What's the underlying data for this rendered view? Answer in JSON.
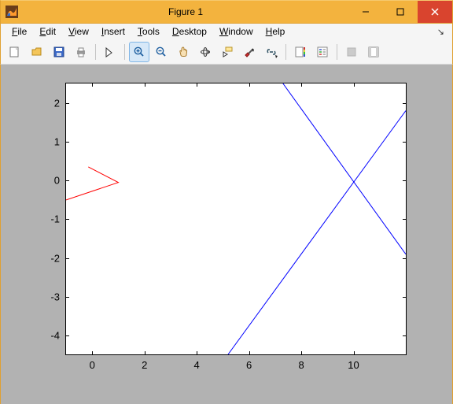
{
  "window": {
    "title": "Figure 1",
    "accent": "#f3b33e",
    "close_color": "#d9442e"
  },
  "menubar": {
    "items": [
      {
        "label": "File",
        "u": "F"
      },
      {
        "label": "Edit",
        "u": "E"
      },
      {
        "label": "View",
        "u": "V"
      },
      {
        "label": "Insert",
        "u": "I"
      },
      {
        "label": "Tools",
        "u": "T"
      },
      {
        "label": "Desktop",
        "u": "D"
      },
      {
        "label": "Window",
        "u": "W"
      },
      {
        "label": "Help",
        "u": "H"
      }
    ]
  },
  "toolbar": {
    "buttons": [
      "new-figure",
      "open",
      "save",
      "print",
      "|",
      "edit-plot",
      "|",
      "zoom-in",
      "zoom-out",
      "pan",
      "rotate3d",
      "data-cursor",
      "brush",
      "link",
      "|",
      "insert-colorbar",
      "insert-legend",
      "|",
      "hide-plot-tools",
      "show-plot-tools"
    ],
    "active": "zoom-in"
  },
  "chart_data": {
    "type": "line",
    "x": [
      -1,
      12
    ],
    "series": [
      {
        "name": "line1",
        "color": "#0000ff",
        "points": [
          [
            5.2,
            -4.48
          ],
          [
            12,
            1.8
          ]
        ]
      },
      {
        "name": "line2",
        "color": "#0000ff",
        "points": [
          [
            7.3,
            2.5
          ],
          [
            12,
            -1.9
          ]
        ]
      },
      {
        "name": "arrow",
        "color": "#ff0000",
        "points": [
          [
            -1,
            -0.5
          ],
          [
            1,
            -0.05
          ],
          [
            -0.15,
            0.35
          ]
        ]
      }
    ],
    "xlim": [
      -1,
      12
    ],
    "ylim": [
      -4.48,
      2.5
    ],
    "xticks": [
      0,
      2,
      4,
      6,
      8,
      10
    ],
    "yticks": [
      -4,
      -3,
      -2,
      -1,
      0,
      1,
      2
    ],
    "xlabel": "",
    "ylabel": "",
    "title": ""
  }
}
